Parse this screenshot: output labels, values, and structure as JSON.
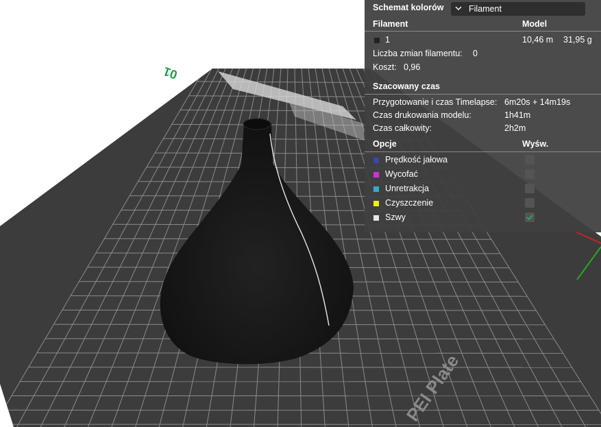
{
  "plate": {
    "number": "01",
    "label": "PEI Plate"
  },
  "colors": {
    "panel_bg": "#404040",
    "plate_bg": "#3c3c3c",
    "plate_grid": "#9a9a9a",
    "model": "#141414",
    "seam": "#e8e8e8",
    "axis_x": "#cc2222",
    "axis_y": "#22aa22",
    "plate_number": "#1f9d45"
  },
  "panel": {
    "color_scheme_label": "Schemat kolorów",
    "color_scheme_value": "Filament",
    "filament_header": "Filament",
    "model_header": "Model",
    "filament": {
      "id": "1",
      "length": "10,46 m",
      "weight": "31,95 g",
      "swatch_color": "#222222"
    },
    "filament_changes_label": "Liczba zmian filamentu:",
    "filament_changes_value": "0",
    "cost_label": "Koszt:",
    "cost_value": "0,96",
    "time_header": "Szacowany czas",
    "prep_label": "Przygotowanie i czas Timelapse:",
    "prep_value": "6m20s + 14m19s",
    "model_time_label": "Czas drukowania modelu:",
    "model_time_value": "1h41m",
    "total_time_label": "Czas całkowity:",
    "total_time_value": "2h2m",
    "options_header": "Opcje",
    "show_header": "Wyśw.",
    "options": [
      {
        "label": "Prędkość jałowa",
        "color": "#3b46b0",
        "checked": false
      },
      {
        "label": "Wycofać",
        "color": "#d430d0",
        "checked": false
      },
      {
        "label": "Unretrakcja",
        "color": "#36a9d0",
        "checked": false
      },
      {
        "label": "Czyszczenie",
        "color": "#f2f200",
        "checked": false
      },
      {
        "label": "Szwy",
        "color": "#e6e6e6",
        "checked": true
      }
    ]
  }
}
